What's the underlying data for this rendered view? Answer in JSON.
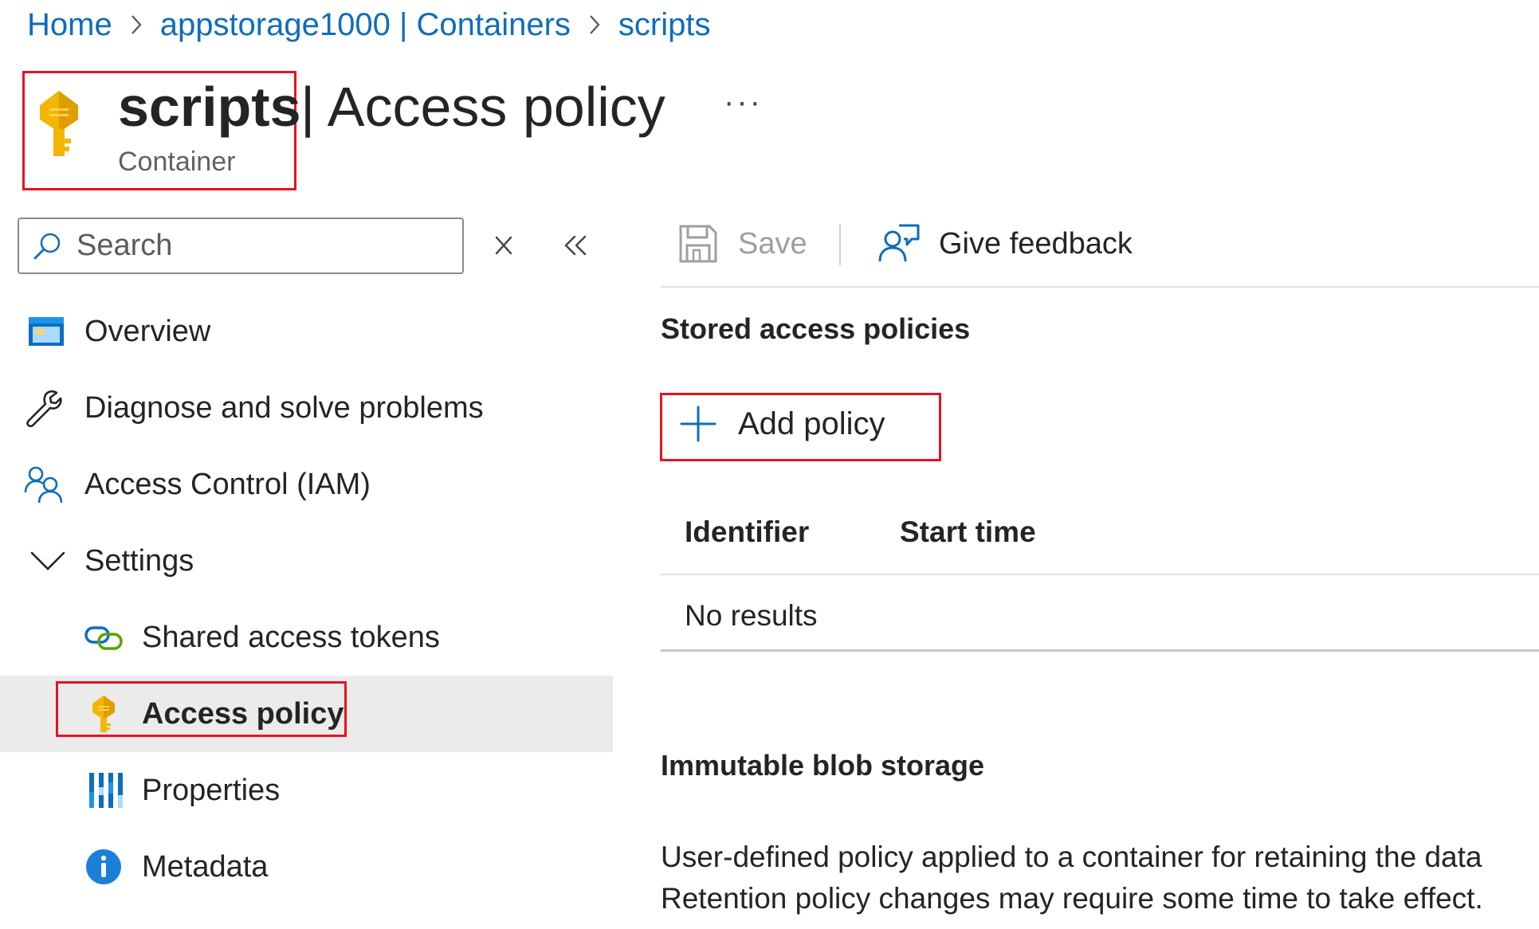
{
  "breadcrumb": {
    "items": [
      "Home",
      "appstorage1000 | Containers",
      "scripts"
    ]
  },
  "header": {
    "resource_name": "scripts",
    "page_title": "| Access policy",
    "resource_type": "Container",
    "more_label": "···"
  },
  "search": {
    "placeholder": "Search"
  },
  "sidebar": {
    "items": [
      {
        "label": "Overview",
        "icon": "overview-icon"
      },
      {
        "label": "Diagnose and solve problems",
        "icon": "wrench-icon"
      },
      {
        "label": "Access Control (IAM)",
        "icon": "people-icon"
      },
      {
        "label": "Settings",
        "icon": "chevron-down-icon"
      },
      {
        "label": "Shared access tokens",
        "icon": "link-icon"
      },
      {
        "label": "Access policy",
        "icon": "key-icon",
        "selected": true
      },
      {
        "label": "Properties",
        "icon": "properties-icon"
      },
      {
        "label": "Metadata",
        "icon": "info-icon"
      }
    ]
  },
  "toolbar": {
    "save_label": "Save",
    "feedback_label": "Give feedback"
  },
  "stored_policies": {
    "heading": "Stored access policies",
    "add_label": "Add policy",
    "columns": [
      "Identifier",
      "Start time"
    ],
    "empty_text": "No results"
  },
  "immutable": {
    "heading": "Immutable blob storage",
    "line1": "User-defined policy applied to a container for retaining the data",
    "line2": "Retention policy changes may require some time to take effect."
  },
  "colors": {
    "accent": "#0f6cbd",
    "highlight_border": "#e81123",
    "key_gold": "#f2b600",
    "selected_bg": "#ebebeb"
  }
}
